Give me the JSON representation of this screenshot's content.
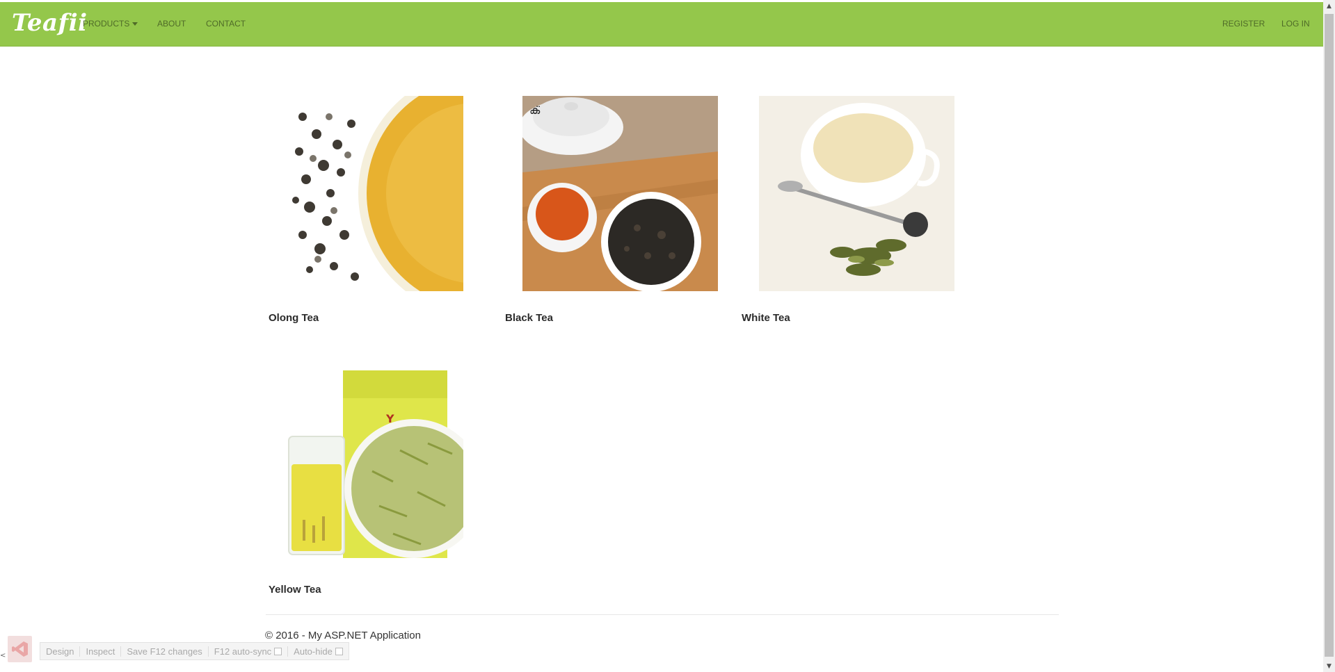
{
  "brand": {
    "name": "Teafii"
  },
  "nav": {
    "left": [
      {
        "label": "PRODUCTS",
        "dropdown": true
      },
      {
        "label": "ABOUT"
      },
      {
        "label": "CONTACT"
      }
    ],
    "right": [
      {
        "label": "REGISTER"
      },
      {
        "label": "LOG IN"
      }
    ]
  },
  "products": [
    {
      "name": "Olong Tea"
    },
    {
      "name": "Black Tea"
    },
    {
      "name": "White Tea"
    },
    {
      "name": "Yellow Tea"
    }
  ],
  "footer": {
    "text": "© 2016 - My ASP.NET Application"
  },
  "browser_link": {
    "items": [
      "Design",
      "Inspect",
      "Save F12 changes",
      "F12 auto-sync",
      "Auto-hide"
    ]
  },
  "colors": {
    "navbar": "#94c74b",
    "nav_text": "#4f6b28"
  }
}
